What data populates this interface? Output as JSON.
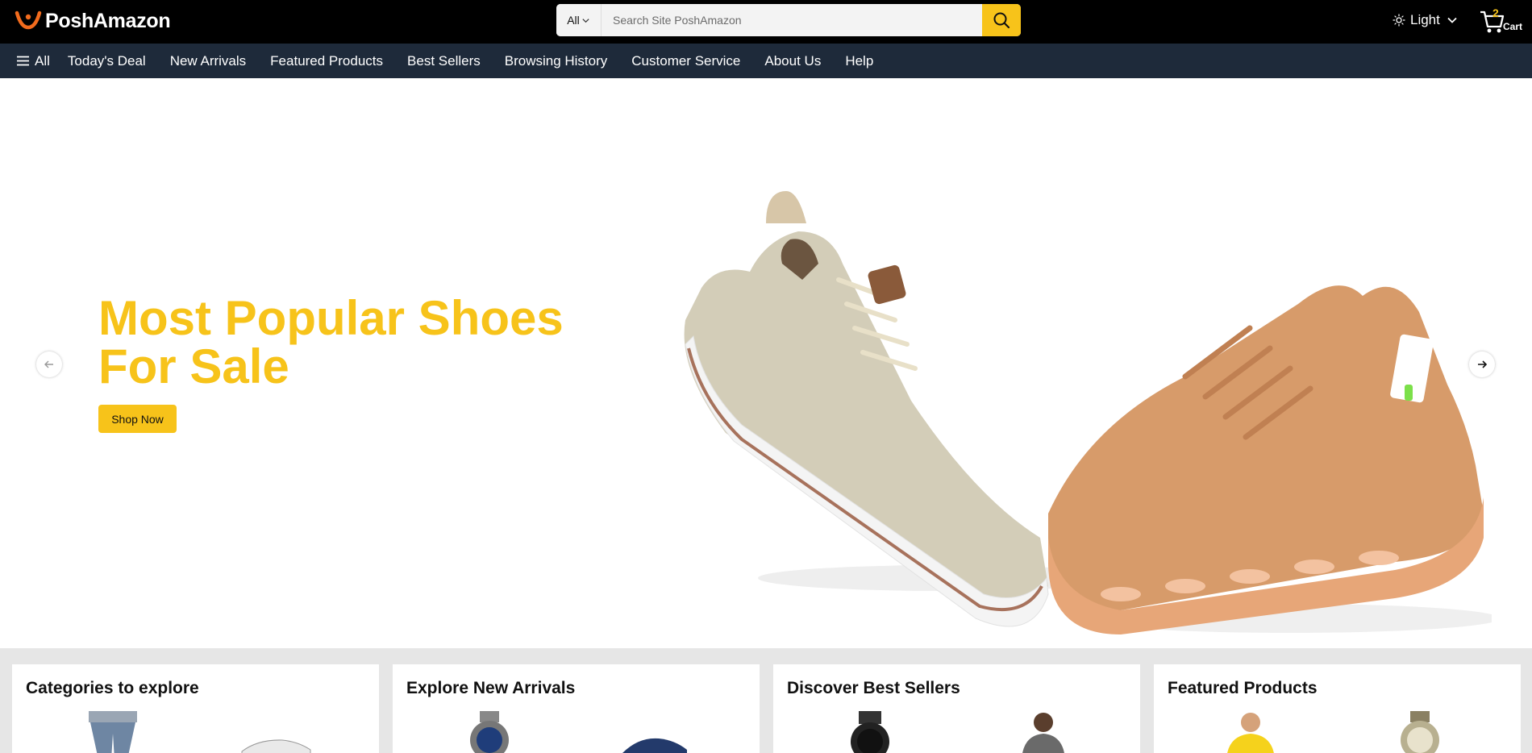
{
  "header": {
    "logo_text": "PoshAmazon",
    "search": {
      "category": "All",
      "placeholder": "Search Site PoshAmazon"
    },
    "theme_label": "Light",
    "cart": {
      "count": "2",
      "label": "Cart"
    }
  },
  "nav": {
    "all_label": "All",
    "items": [
      "Today's Deal",
      "New Arrivals",
      "Featured Products",
      "Best Sellers",
      "Browsing History",
      "Customer Service",
      "About Us",
      "Help"
    ]
  },
  "hero": {
    "title": "Most Popular Shoes For Sale",
    "cta_label": "Shop Now"
  },
  "cards": [
    {
      "title": "Categories to explore"
    },
    {
      "title": "Explore New Arrivals"
    },
    {
      "title": "Discover Best Sellers"
    },
    {
      "title": "Featured Products"
    }
  ],
  "colors": {
    "accent": "#f7c31a",
    "header_bg": "#000000",
    "nav_bg": "#1e2a3a",
    "page_strip": "#e6e6e6"
  }
}
